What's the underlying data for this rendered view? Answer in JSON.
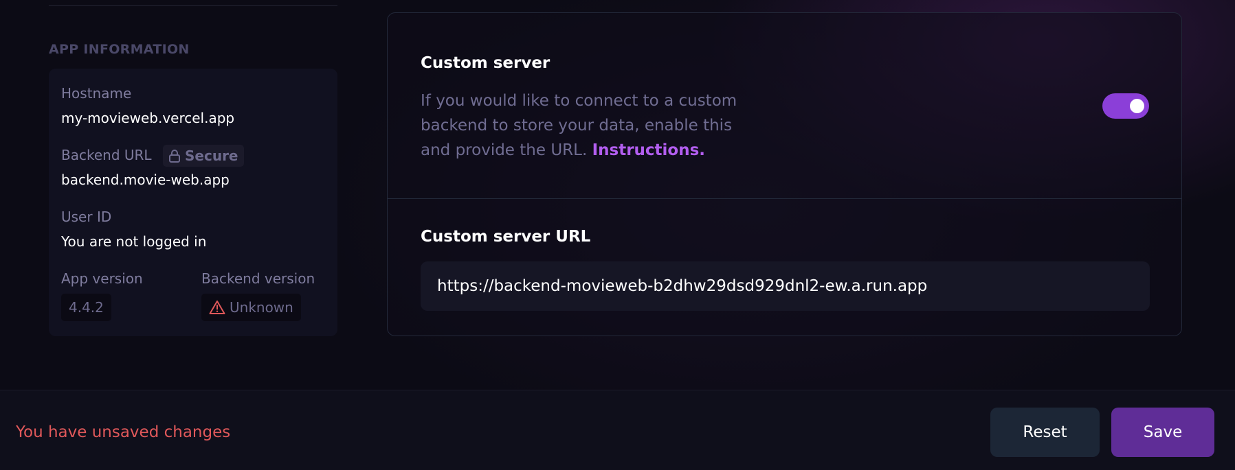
{
  "app_info": {
    "section_title": "APP INFORMATION",
    "hostname_label": "Hostname",
    "hostname_value": "my-movieweb.vercel.app",
    "backend_url_label": "Backend URL",
    "secure_badge": "Secure",
    "secure_icon": "lock-icon",
    "backend_url_value": "backend.movie-web.app",
    "user_id_label": "User ID",
    "user_id_value": "You are not logged in",
    "app_version_label": "App version",
    "app_version_value": "4.4.2",
    "backend_version_label": "Backend version",
    "backend_version_value": "Unknown",
    "backend_version_icon": "warning-icon"
  },
  "custom_server": {
    "title": "Custom server",
    "description": "If you would like to connect to a custom backend to store your data, enable this and provide the URL.",
    "instructions_link": "Instructions.",
    "toggle_enabled": true,
    "url_title": "Custom server URL",
    "url_value": "https://backend-movieweb-b2dhw29dsd929dnl2-ew.a.run.app"
  },
  "footer": {
    "unsaved_message": "You have unsaved changes",
    "reset_label": "Reset",
    "save_label": "Save"
  },
  "colors": {
    "accent": "#8b3fd8",
    "link": "#b35ef0",
    "warning": "#e0585a",
    "save_button": "#5f2d97",
    "reset_button": "#1c2636"
  }
}
